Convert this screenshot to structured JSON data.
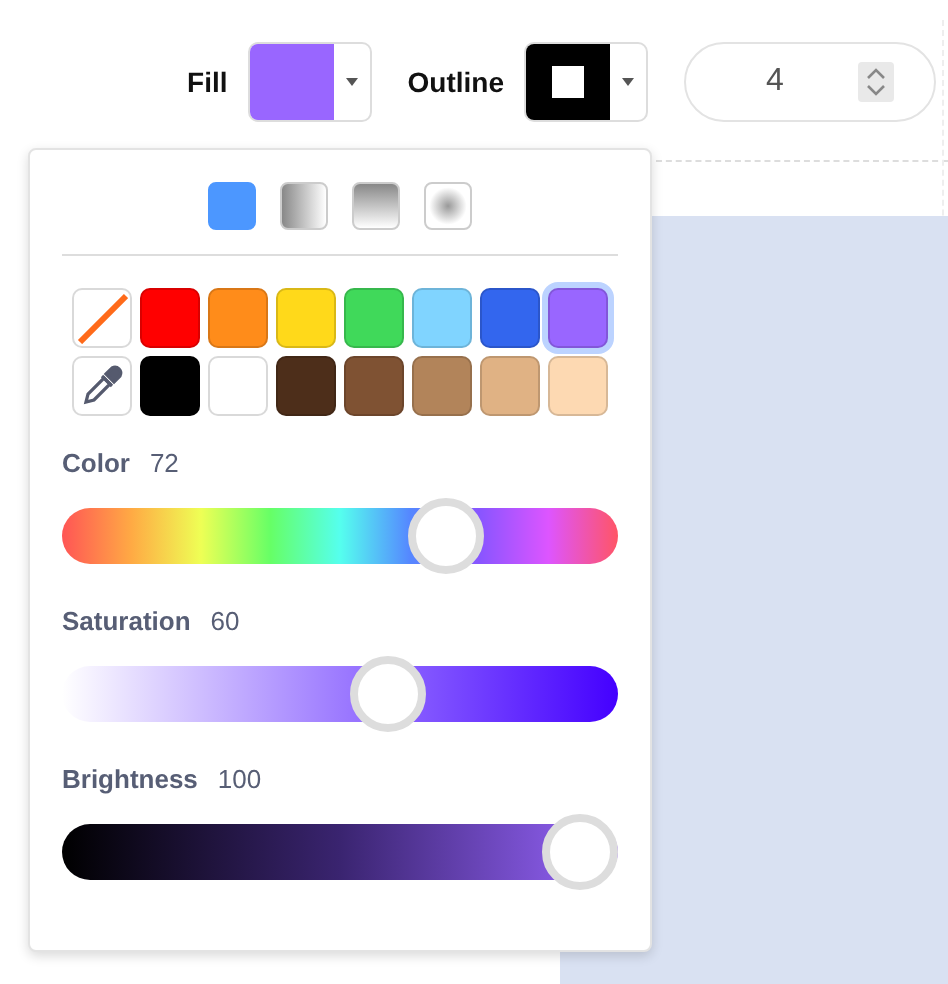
{
  "toolbar": {
    "fill": {
      "label": "Fill",
      "color": "#9966ff"
    },
    "outline": {
      "label": "Outline",
      "color": "#000000"
    },
    "width": {
      "value": "4"
    }
  },
  "popover": {
    "modes": [
      {
        "kind": "solid"
      },
      {
        "kind": "horizontal"
      },
      {
        "kind": "vertical"
      },
      {
        "kind": "radial"
      }
    ],
    "swatches": [
      {
        "kind": "none",
        "selected": false
      },
      {
        "kind": "color",
        "color": "#ff0000",
        "selected": false
      },
      {
        "kind": "color",
        "color": "#ff8c1a",
        "selected": false
      },
      {
        "kind": "color",
        "color": "#ffd91a",
        "selected": false
      },
      {
        "kind": "color",
        "color": "#40d95a",
        "selected": false
      },
      {
        "kind": "color",
        "color": "#80d4ff",
        "selected": false
      },
      {
        "kind": "color",
        "color": "#3366ee",
        "selected": false
      },
      {
        "kind": "color",
        "color": "#9966ff",
        "selected": true
      },
      {
        "kind": "picker",
        "selected": false
      },
      {
        "kind": "color",
        "color": "#000000",
        "selected": false
      },
      {
        "kind": "color",
        "color": "#ffffff",
        "selected": false
      },
      {
        "kind": "color",
        "color": "#4d2e1a",
        "selected": false
      },
      {
        "kind": "color",
        "color": "#7f5233",
        "selected": false
      },
      {
        "kind": "color",
        "color": "#b2845a",
        "selected": false
      },
      {
        "kind": "color",
        "color": "#e0b284",
        "selected": false
      },
      {
        "kind": "color",
        "color": "#fdd9b2",
        "selected": false
      }
    ],
    "sliders": [
      {
        "kind": "hue",
        "label": "Color",
        "value": "72",
        "level": 0.72
      },
      {
        "kind": "saturation",
        "label": "Saturation",
        "value": "60",
        "level": 0.6
      },
      {
        "kind": "brightness",
        "label": "Brightness",
        "value": "100",
        "level": 1
      }
    ]
  }
}
